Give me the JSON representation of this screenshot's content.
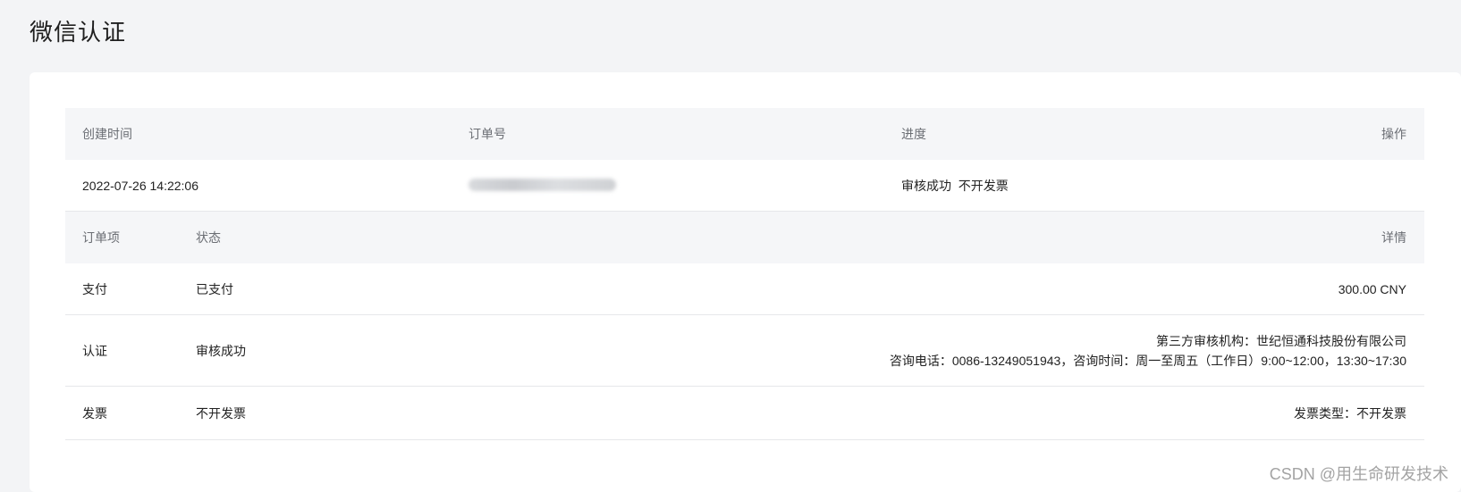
{
  "page": {
    "title": "微信认证"
  },
  "order_table": {
    "headers": {
      "created_time": "创建时间",
      "order_no": "订单号",
      "progress": "进度",
      "actions": "操作"
    },
    "row": {
      "created_time": "2022-07-26 14:22:06",
      "order_no": "",
      "progress_status": "审核成功",
      "progress_invoice": "不开发票"
    }
  },
  "items_table": {
    "headers": {
      "item": "订单项",
      "status": "状态",
      "detail": "详情"
    },
    "rows": [
      {
        "item": "支付",
        "status": "已支付",
        "detail": "300.00 CNY"
      },
      {
        "item": "认证",
        "status": "审核成功",
        "detail_line1": "第三方审核机构：世纪恒通科技股份有限公司",
        "detail_line2": "咨询电话：0086-13249051943，咨询时间：周一至周五（工作日）9:00~12:00，13:30~17:30"
      },
      {
        "item": "发票",
        "status": "不开发票",
        "detail": "发票类型：不开发票"
      }
    ]
  },
  "watermark": "CSDN @用生命研发技术"
}
